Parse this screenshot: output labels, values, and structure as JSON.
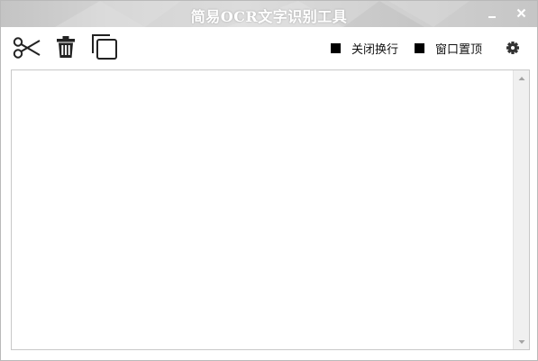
{
  "window": {
    "title": "简易OCR文字识别工具"
  },
  "toolbar": {
    "tools": [
      {
        "icon": "scissors-icon",
        "action": "cut"
      },
      {
        "icon": "trash-icon",
        "action": "delete"
      },
      {
        "icon": "copy-icon",
        "action": "copy"
      }
    ],
    "options": [
      {
        "label": "关闭换行",
        "checked": true
      },
      {
        "label": "窗口置顶",
        "checked": true
      }
    ],
    "settings_icon": "gear-icon"
  },
  "editor": {
    "content": ""
  },
  "colors": {
    "titlebar": "#d0d0d0",
    "title_text": "#ffffff",
    "checkbox": "#000000",
    "border": "#c8c8c8",
    "scrollbar": "#f0f0f0"
  }
}
